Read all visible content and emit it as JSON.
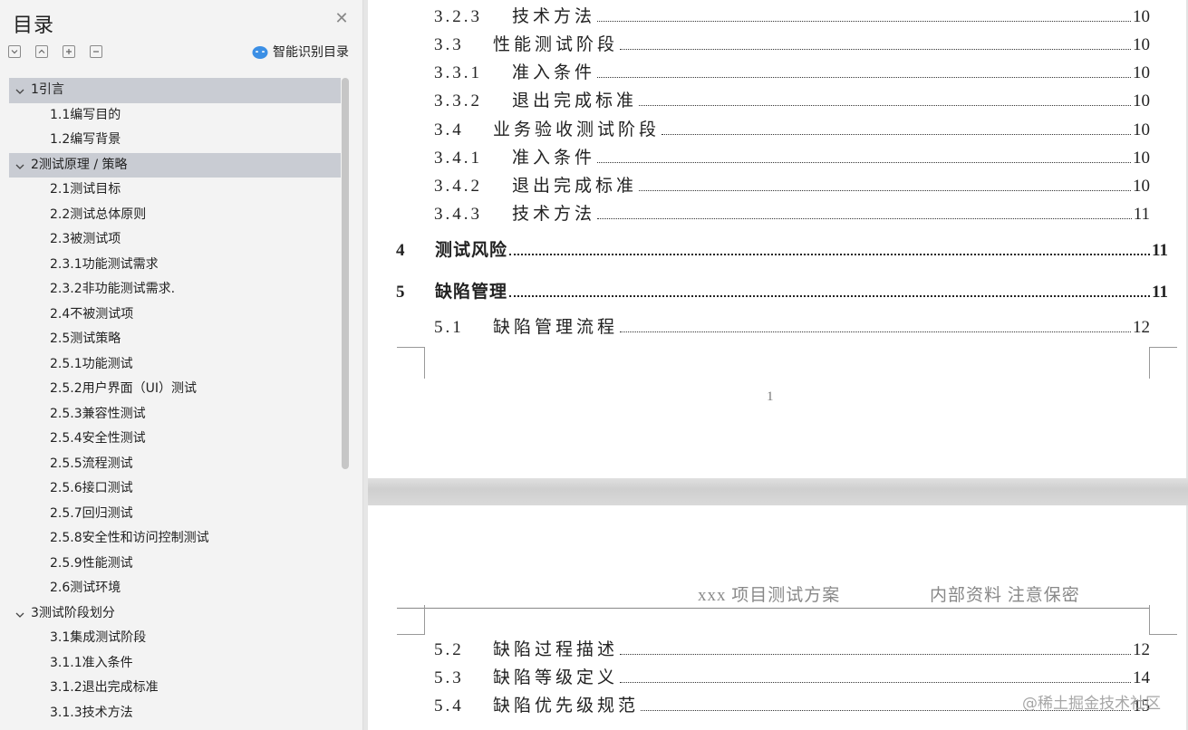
{
  "sidebar": {
    "title": "目录",
    "close_icon": "close-icon",
    "tools": [
      "collapse-all-icon",
      "expand-all-icon",
      "plus-icon",
      "minus-icon"
    ],
    "smart_label": "智能识别目录",
    "smart_icon": "smart-recognize-icon",
    "items": [
      {
        "label": "1引言",
        "level": 1,
        "expanded": true,
        "selected": true
      },
      {
        "label": "1.1编写目的",
        "level": 2
      },
      {
        "label": "1.2编写背景",
        "level": 2
      },
      {
        "label": "2测试原理 / 策略",
        "level": 1,
        "expanded": true,
        "selected": true
      },
      {
        "label": "2.1测试目标",
        "level": 2
      },
      {
        "label": "2.2测试总体原则",
        "level": 2
      },
      {
        "label": "2.3被测试项",
        "level": 2
      },
      {
        "label": "2.3.1功能测试需求",
        "level": 2
      },
      {
        "label": "2.3.2非功能测试需求.",
        "level": 2
      },
      {
        "label": "2.4不被测试项",
        "level": 2
      },
      {
        "label": "2.5测试策略",
        "level": 2
      },
      {
        "label": "2.5.1功能测试",
        "level": 2
      },
      {
        "label": "2.5.2用户界面（UI）测试",
        "level": 2
      },
      {
        "label": "2.5.3兼容性测试",
        "level": 2
      },
      {
        "label": "2.5.4安全性测试",
        "level": 2
      },
      {
        "label": "2.5.5流程测试",
        "level": 2
      },
      {
        "label": "2.5.6接口测试",
        "level": 2
      },
      {
        "label": "2.5.7回归测试",
        "level": 2
      },
      {
        "label": "2.5.8安全性和访问控制测试",
        "level": 2
      },
      {
        "label": "2.5.9性能测试",
        "level": 2
      },
      {
        "label": "2.6测试环境",
        "level": 2
      },
      {
        "label": "3测试阶段划分",
        "level": 1,
        "expanded": true,
        "selected": false
      },
      {
        "label": "3.1集成测试阶段",
        "level": 2
      },
      {
        "label": "3.1.1准入条件",
        "level": 2
      },
      {
        "label": "3.1.2退出完成标准",
        "level": 2
      },
      {
        "label": "3.1.3技术方法",
        "level": 2
      }
    ]
  },
  "document": {
    "page1": {
      "entries": [
        {
          "num": "3.2.3",
          "title": "技术方法",
          "page": "10",
          "style": "sub"
        },
        {
          "num": "3.3",
          "title": "性能测试阶段",
          "page": "10",
          "style": "sub"
        },
        {
          "num": "3.3.1",
          "title": "准入条件",
          "page": "10",
          "style": "sub"
        },
        {
          "num": "3.3.2",
          "title": "退出完成标准",
          "page": "10",
          "style": "sub"
        },
        {
          "num": "3.4",
          "title": "业务验收测试阶段",
          "page": "10",
          "style": "sub"
        },
        {
          "num": "3.4.1",
          "title": "准入条件",
          "page": "10",
          "style": "sub"
        },
        {
          "num": "3.4.2",
          "title": "退出完成标准",
          "page": "10",
          "style": "sub"
        },
        {
          "num": "3.4.3",
          "title": "技术方法",
          "page": "11",
          "style": "sub"
        },
        {
          "num": "4",
          "title": "测试风险",
          "page": "11",
          "style": "main"
        },
        {
          "num": "5",
          "title": "缺陷管理",
          "page": "11",
          "style": "main"
        },
        {
          "num": "5.1",
          "title": "缺陷管理流程",
          "page": "12",
          "style": "sub"
        }
      ],
      "page_number": "1"
    },
    "page2": {
      "header_left": "xxx 项目测试方案",
      "header_right": "内部资料  注意保密",
      "entries": [
        {
          "num": "5.2",
          "title": "缺陷过程描述",
          "page": "12",
          "style": "sub"
        },
        {
          "num": "5.3",
          "title": "缺陷等级定义",
          "page": "14",
          "style": "sub"
        },
        {
          "num": "5.4",
          "title": "缺陷优先级规范",
          "page": "15",
          "style": "sub"
        }
      ]
    }
  },
  "watermark": "@稀土掘金技术社区",
  "colors": {
    "selected_row": "#c9ccd3",
    "sidebar_bg": "#f3f3f3",
    "smart_icon": "#3b8fe5"
  }
}
